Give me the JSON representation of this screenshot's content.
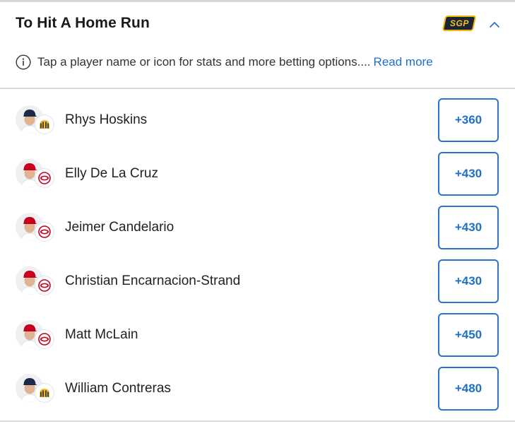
{
  "header": {
    "title": "To Hit A Home Run",
    "badge": "SGP"
  },
  "info": {
    "text": "Tap a player name or icon for stats and more betting options....",
    "link": "Read more"
  },
  "players": [
    {
      "name": "Rhys Hoskins",
      "odds": "+360",
      "team": "brewers",
      "cap_color": "#1b2a4a"
    },
    {
      "name": "Elly De La Cruz",
      "odds": "+430",
      "team": "reds",
      "cap_color": "#c6011f"
    },
    {
      "name": "Jeimer Candelario",
      "odds": "+430",
      "team": "reds",
      "cap_color": "#c6011f"
    },
    {
      "name": "Christian Encarnacion-Strand",
      "odds": "+430",
      "team": "reds",
      "cap_color": "#c6011f"
    },
    {
      "name": "Matt McLain",
      "odds": "+450",
      "team": "reds",
      "cap_color": "#c6011f"
    },
    {
      "name": "William Contreras",
      "odds": "+480",
      "team": "brewers",
      "cap_color": "#1b2a4a"
    }
  ],
  "colors": {
    "accent": "#1f6fc7",
    "sgp_gold": "#f2b705",
    "sgp_bg": "#1b2436",
    "reds": "#c6011f",
    "brewers": "#13294b"
  }
}
